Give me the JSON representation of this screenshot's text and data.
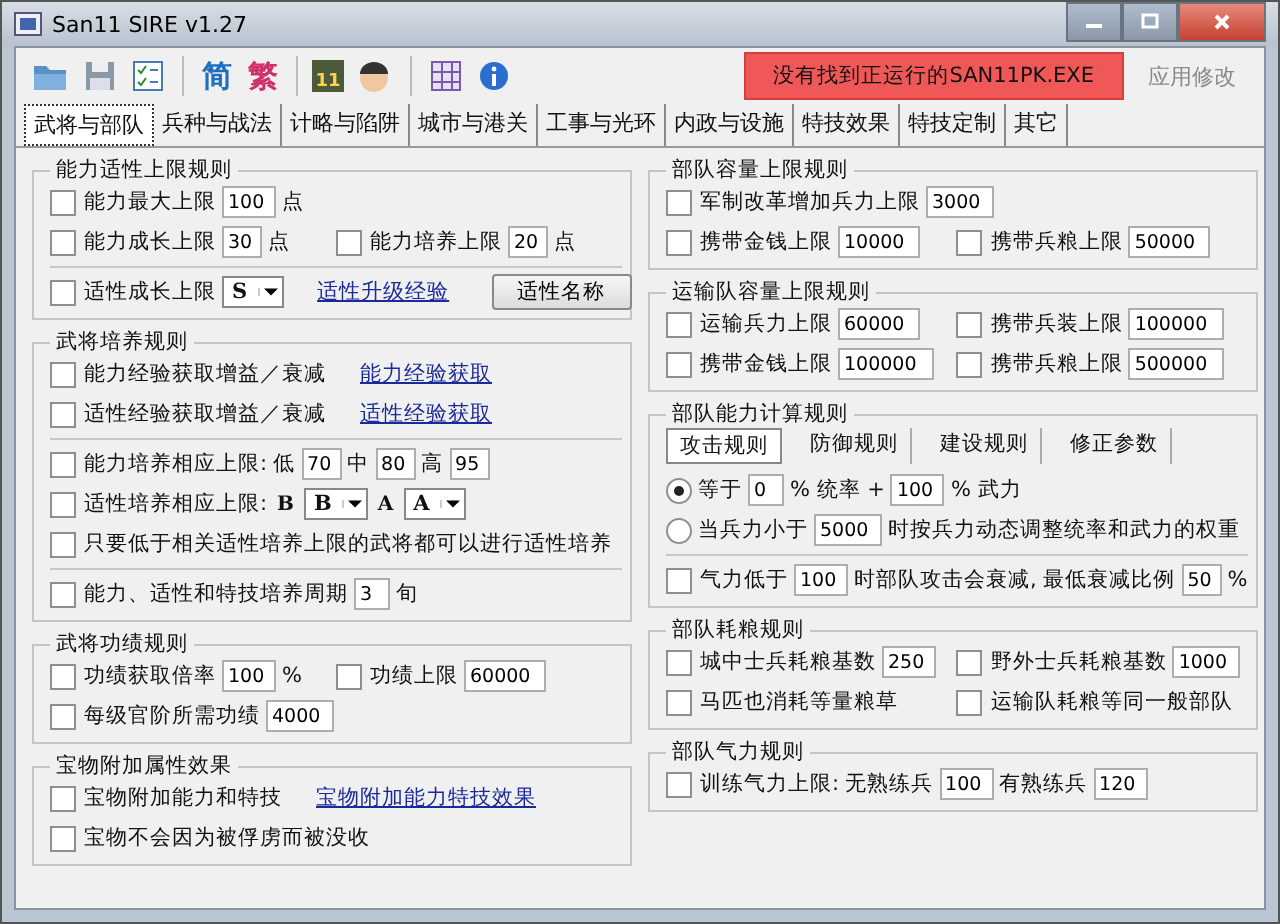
{
  "window": {
    "title": "San11 SIRE v1.27"
  },
  "toolbar": {
    "script_buttons": [
      {
        "label": "简",
        "color": "#1f6fc0"
      },
      {
        "label": "繁",
        "color": "#d0306a"
      }
    ],
    "calendar_text": "11"
  },
  "status": {
    "text": "没有找到正运行的SAN11PK.EXE",
    "apply_button": {
      "label": "应用修改",
      "disabled": true
    }
  },
  "tabs": [
    {
      "label": "武将与部队",
      "selected": true
    },
    {
      "label": "兵种与战法",
      "selected": false
    },
    {
      "label": "计略与陷阱",
      "selected": false
    },
    {
      "label": "城市与港关",
      "selected": false
    },
    {
      "label": "工事与光环",
      "selected": false
    },
    {
      "label": "内政与设施",
      "selected": false
    },
    {
      "label": "特技效果",
      "selected": false
    },
    {
      "label": "特技定制",
      "selected": false
    },
    {
      "label": "其它",
      "selected": false
    }
  ],
  "left_groups": [
    {
      "title": "能力适性上限规则",
      "rows": [
        {
          "kind": "row",
          "cells": [
            [
              {
                "kind": "check",
                "label": "能力最大上限",
                "checked": false
              },
              {
                "kind": "field",
                "value": "100"
              },
              {
                "kind": "text",
                "text": "点"
              }
            ]
          ]
        },
        {
          "kind": "row",
          "cells": [
            [
              {
                "kind": "check",
                "label": "能力成长上限",
                "checked": false
              },
              {
                "kind": "field",
                "value": "30"
              },
              {
                "kind": "text",
                "text": "点"
              }
            ],
            [
              {
                "kind": "check",
                "label": "能力培养上限",
                "checked": false
              },
              {
                "kind": "field",
                "value": "20"
              },
              {
                "kind": "text",
                "text": "点"
              }
            ]
          ]
        },
        {
          "kind": "divider"
        },
        {
          "kind": "row",
          "cells": [
            [
              {
                "kind": "check",
                "label": "适性成长上限",
                "checked": false
              },
              {
                "kind": "select",
                "value": "S"
              },
              {
                "kind": "link",
                "text": "适性升级经验"
              },
              {
                "kind": "button",
                "label": "适性名称"
              }
            ]
          ]
        }
      ]
    },
    {
      "title": "武将培养规则",
      "rows": [
        {
          "kind": "row",
          "cells": [
            [
              {
                "kind": "check",
                "label": "能力经验获取增益／衰减",
                "checked": false
              },
              {
                "kind": "link",
                "text": "能力经验获取"
              }
            ]
          ]
        },
        {
          "kind": "row",
          "cells": [
            [
              {
                "kind": "check",
                "label": "适性经验获取增益／衰减",
                "checked": false
              },
              {
                "kind": "link",
                "text": "适性经验获取"
              }
            ]
          ]
        },
        {
          "kind": "divider"
        },
        {
          "kind": "row",
          "cells": [
            [
              {
                "kind": "check",
                "label": "能力培养相应上限:",
                "checked": false
              },
              {
                "kind": "text",
                "text": "低"
              },
              {
                "kind": "field",
                "value": "70"
              },
              {
                "kind": "text",
                "text": "中"
              },
              {
                "kind": "field",
                "value": "80"
              },
              {
                "kind": "text",
                "text": "高"
              },
              {
                "kind": "field",
                "value": "95"
              }
            ]
          ]
        },
        {
          "kind": "row",
          "cells": [
            [
              {
                "kind": "check",
                "label": "适性培养相应上限:",
                "checked": false
              },
              {
                "kind": "grade",
                "text": "B"
              },
              {
                "kind": "select",
                "value": "B"
              },
              {
                "kind": "grade",
                "text": "A"
              },
              {
                "kind": "select",
                "value": "A"
              }
            ]
          ]
        },
        {
          "kind": "row",
          "cells": [
            [
              {
                "kind": "check",
                "label": "只要低于相关适性培养上限的武将都可以进行适性培养",
                "checked": false
              }
            ]
          ]
        },
        {
          "kind": "divider"
        },
        {
          "kind": "row",
          "cells": [
            [
              {
                "kind": "check",
                "label": "能力、适性和特技培养周期",
                "checked": false
              },
              {
                "kind": "field",
                "value": "3"
              },
              {
                "kind": "text",
                "text": "旬"
              }
            ]
          ]
        }
      ]
    },
    {
      "title": "武将功绩规则",
      "rows": [
        {
          "kind": "row",
          "cells": [
            [
              {
                "kind": "check",
                "label": "功绩获取倍率",
                "checked": false
              },
              {
                "kind": "field",
                "value": "100"
              },
              {
                "kind": "text",
                "text": "%"
              }
            ],
            [
              {
                "kind": "check",
                "label": "功绩上限",
                "checked": false
              },
              {
                "kind": "field",
                "value": "60000"
              }
            ]
          ]
        },
        {
          "kind": "row",
          "cells": [
            [
              {
                "kind": "check",
                "label": "每级官阶所需功绩",
                "checked": false
              },
              {
                "kind": "field",
                "value": "4000"
              }
            ]
          ]
        }
      ]
    },
    {
      "title": "宝物附加属性效果",
      "rows": [
        {
          "kind": "row",
          "cells": [
            [
              {
                "kind": "check",
                "label": "宝物附加能力和特技",
                "checked": false
              },
              {
                "kind": "link",
                "text": "宝物附加能力特技效果"
              }
            ]
          ]
        },
        {
          "kind": "row",
          "cells": [
            [
              {
                "kind": "check",
                "label": "宝物不会因为被俘虏而被没收",
                "checked": false
              }
            ]
          ]
        }
      ]
    }
  ],
  "right_groups": [
    {
      "title": "部队容量上限规则",
      "rows": [
        {
          "kind": "row",
          "cells": [
            [
              {
                "kind": "check",
                "label": "军制改革增加兵力上限",
                "checked": false
              },
              {
                "kind": "field",
                "value": "3000"
              }
            ]
          ]
        },
        {
          "kind": "row",
          "cells": [
            [
              {
                "kind": "check",
                "label": "携带金钱上限",
                "checked": false
              },
              {
                "kind": "field",
                "value": "10000"
              }
            ],
            [
              {
                "kind": "check",
                "label": "携带兵粮上限",
                "checked": false
              },
              {
                "kind": "field",
                "value": "50000"
              }
            ]
          ]
        }
      ]
    },
    {
      "title": "运输队容量上限规则",
      "rows": [
        {
          "kind": "row",
          "cells": [
            [
              {
                "kind": "check",
                "label": "运输兵力上限",
                "checked": false
              },
              {
                "kind": "field",
                "value": "60000"
              }
            ],
            [
              {
                "kind": "check",
                "label": "携带兵装上限",
                "checked": false
              },
              {
                "kind": "field",
                "value": "100000"
              }
            ]
          ]
        },
        {
          "kind": "row",
          "cells": [
            [
              {
                "kind": "check",
                "label": "携带金钱上限",
                "checked": false
              },
              {
                "kind": "field",
                "value": "100000"
              }
            ],
            [
              {
                "kind": "check",
                "label": "携带兵粮上限",
                "checked": false
              },
              {
                "kind": "field",
                "value": "500000"
              }
            ]
          ]
        }
      ]
    },
    {
      "title": "部队能力计算规则",
      "tabs": [
        {
          "label": "攻击规则",
          "selected": true
        },
        {
          "label": "防御规则",
          "selected": false
        },
        {
          "label": "建设规则",
          "selected": false
        },
        {
          "label": "修正参数",
          "selected": false
        }
      ],
      "rows": [
        {
          "kind": "row",
          "cells": [
            [
              {
                "kind": "radio",
                "label": "等于",
                "selected": true
              },
              {
                "kind": "field",
                "value": "0"
              },
              {
                "kind": "text",
                "text": "% 统率 +"
              },
              {
                "kind": "field",
                "value": "100"
              },
              {
                "kind": "text",
                "text": "% 武力"
              }
            ]
          ]
        },
        {
          "kind": "row",
          "cells": [
            [
              {
                "kind": "radio",
                "label": "当兵力小于",
                "selected": false
              },
              {
                "kind": "field",
                "value": "5000"
              },
              {
                "kind": "text",
                "text": "时按兵力动态调整统率和武力的权重"
              }
            ]
          ]
        },
        {
          "kind": "divider"
        },
        {
          "kind": "row",
          "cells": [
            [
              {
                "kind": "check",
                "label": "气力低于",
                "checked": false
              },
              {
                "kind": "field",
                "value": "100"
              },
              {
                "kind": "text",
                "text": "时部队攻击会衰减, 最低衰减比例"
              },
              {
                "kind": "field",
                "value": "50"
              },
              {
                "kind": "text",
                "text": "%"
              }
            ]
          ]
        }
      ]
    },
    {
      "title": "部队耗粮规则",
      "rows": [
        {
          "kind": "row",
          "cells": [
            [
              {
                "kind": "check",
                "label": "城中士兵耗粮基数",
                "checked": false
              },
              {
                "kind": "field",
                "value": "250"
              }
            ],
            [
              {
                "kind": "check",
                "label": "野外士兵耗粮基数",
                "checked": false
              },
              {
                "kind": "field",
                "value": "1000"
              }
            ]
          ]
        },
        {
          "kind": "row",
          "cells": [
            [
              {
                "kind": "check",
                "label": "马匹也消耗等量粮草",
                "checked": false
              }
            ],
            [
              {
                "kind": "check",
                "label": "运输队耗粮等同一般部队",
                "checked": false
              }
            ]
          ]
        }
      ]
    },
    {
      "title": "部队气力规则",
      "rows": [
        {
          "kind": "row",
          "cells": [
            [
              {
                "kind": "check",
                "label": "训练气力上限:",
                "checked": false
              },
              {
                "kind": "text",
                "text": "无熟练兵"
              },
              {
                "kind": "field",
                "value": "100"
              },
              {
                "kind": "text",
                "text": "有熟练兵"
              },
              {
                "kind": "field",
                "value": "120"
              }
            ]
          ]
        }
      ]
    }
  ]
}
